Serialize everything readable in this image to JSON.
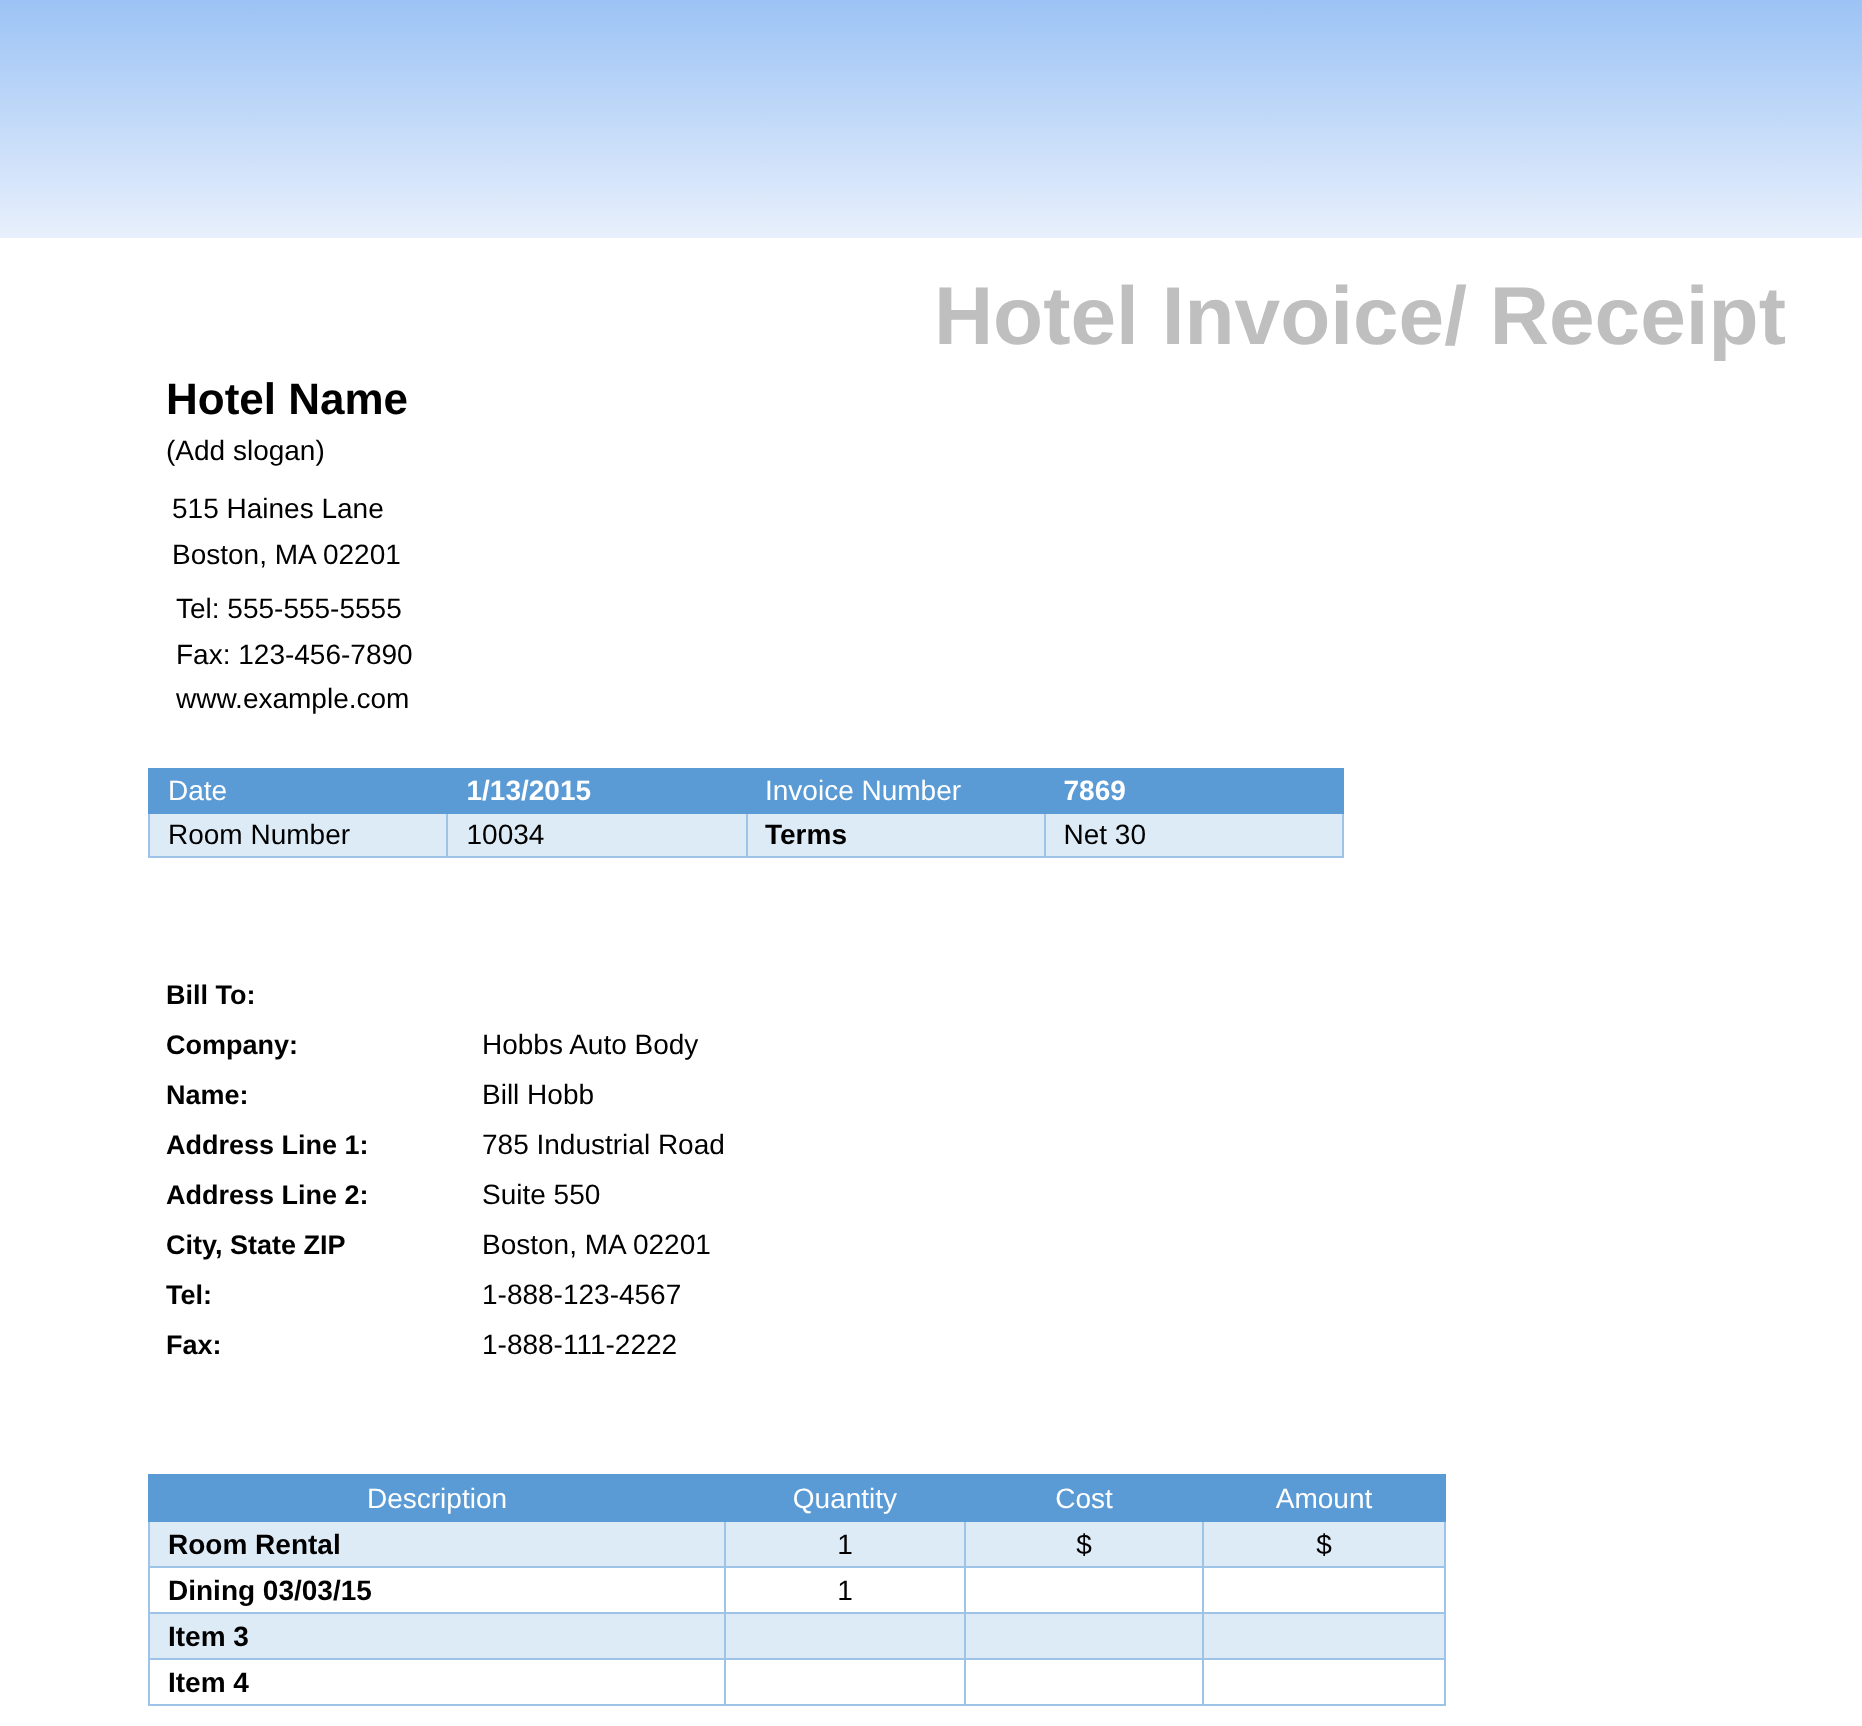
{
  "header": {
    "title": "Hotel Invoice/ Receipt"
  },
  "hotel": {
    "name": "Hotel Name",
    "slogan": "(Add slogan)",
    "address": [
      "515 Haines Lane",
      "Boston, MA 02201"
    ],
    "contact": [
      "Tel: 555-555-5555",
      "Fax: 123-456-7890",
      "www.example.com"
    ]
  },
  "info_table": {
    "rows": [
      [
        {
          "text": "Date",
          "bold": false
        },
        {
          "text": "1/13/2015",
          "bold": true
        },
        {
          "text": "Invoice Number",
          "bold": false
        },
        {
          "text": "7869",
          "bold": true
        }
      ],
      [
        {
          "text": "Room Number",
          "bold": false
        },
        {
          "text": "10034",
          "bold": false
        },
        {
          "text": "Terms",
          "bold": true
        },
        {
          "text": "Net 30",
          "bold": false
        }
      ]
    ]
  },
  "bill_to": {
    "heading": "Bill To:",
    "fields": [
      {
        "label": "Company:",
        "value": "Hobbs Auto Body"
      },
      {
        "label": "Name:",
        "value": "Bill Hobb"
      },
      {
        "label": "Address Line 1:",
        "value": "785 Industrial Road"
      },
      {
        "label": "Address Line 2:",
        "value": "Suite 550"
      },
      {
        "label": "City, State ZIP",
        "value": "Boston, MA 02201"
      },
      {
        "label": "Tel:",
        "value": "1-888-123-4567"
      },
      {
        "label": "Fax:",
        "value": "1-888-111-2222"
      }
    ]
  },
  "items_table": {
    "columns": [
      "Description",
      "Quantity",
      "Cost",
      "Amount"
    ],
    "rows": [
      {
        "description": "Room Rental",
        "quantity": "1",
        "cost": "$",
        "amount": "$"
      },
      {
        "description": "Dining 03/03/15",
        "quantity": "1"
      },
      {
        "description": "Item 3"
      },
      {
        "description": "Item 4"
      }
    ]
  }
}
